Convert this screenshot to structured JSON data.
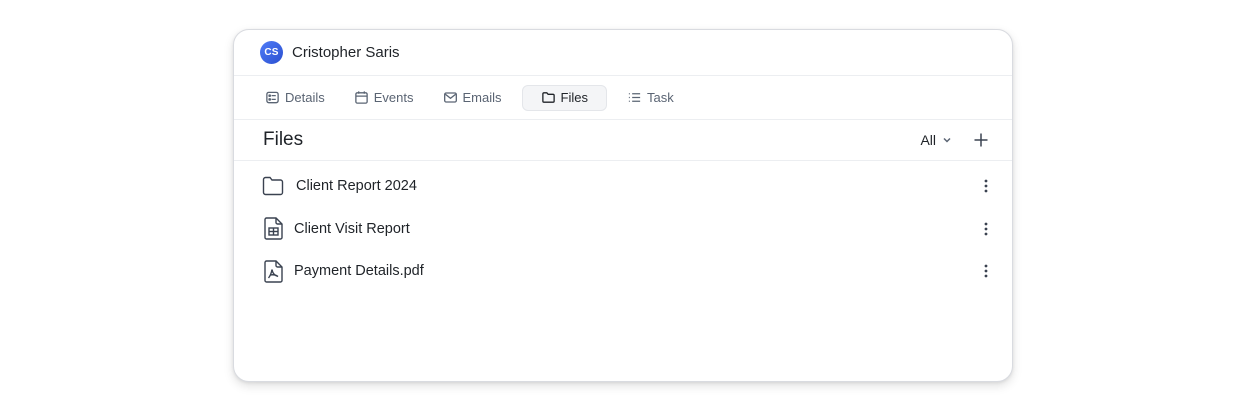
{
  "user": {
    "initials": "CS",
    "name": "Cristopher Saris"
  },
  "tabs": [
    {
      "label": "Details",
      "icon": "details-icon"
    },
    {
      "label": "Events",
      "icon": "calendar-icon"
    },
    {
      "label": "Emails",
      "icon": "mail-icon"
    },
    {
      "label": "Files",
      "icon": "folder-icon",
      "active": true
    },
    {
      "label": "Task",
      "icon": "list-icon"
    }
  ],
  "files_section": {
    "title": "Files",
    "filter_label": "All",
    "items": [
      {
        "name": "Client Report 2024",
        "icon": "folder-icon"
      },
      {
        "name": "Client Visit Report",
        "icon": "spreadsheet-file-icon"
      },
      {
        "name": "Payment Details.pdf",
        "icon": "pdf-file-icon"
      }
    ]
  },
  "colors": {
    "avatar": "#3b63e6",
    "text": "#1f2328",
    "muted": "#5a6473",
    "active_tab_bg": "#f4f5f7"
  }
}
